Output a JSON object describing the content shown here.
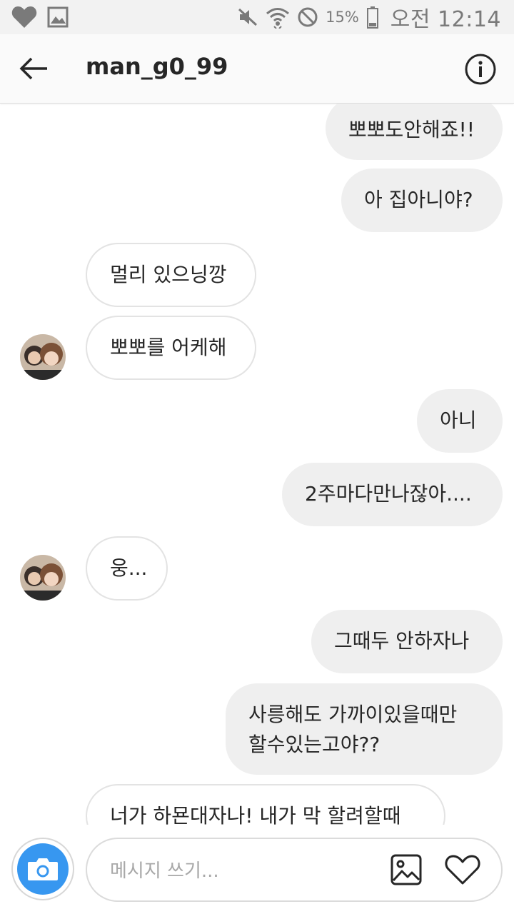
{
  "status_bar": {
    "icons": [
      "heart-icon",
      "gallery-icon",
      "mute-icon",
      "wifi-icon",
      "block-icon",
      "battery-icon"
    ],
    "battery_percent": "15%",
    "time": "오전 12:14"
  },
  "header": {
    "back_icon": "back-arrow-icon",
    "title": "man_g0_99",
    "info_icon": "info-icon"
  },
  "messages": [
    {
      "direction": "outgoing",
      "text": "뽀뽀도안해죠!!"
    },
    {
      "direction": "outgoing",
      "text": "아 집아니야?"
    },
    {
      "direction": "incoming",
      "text": "멀리 있으닝깡"
    },
    {
      "direction": "incoming",
      "text": "뽀뽀를 어케해",
      "avatar": true
    },
    {
      "direction": "outgoing",
      "text": "아니"
    },
    {
      "direction": "outgoing",
      "text": "2주마다만나잖아...."
    },
    {
      "direction": "incoming",
      "text": "웅...",
      "avatar": true
    },
    {
      "direction": "outgoing",
      "text": "그때두 안하자나"
    },
    {
      "direction": "outgoing",
      "lines": [
        "사릉해도 가까이있을때만",
        "할수있는고야??"
      ]
    },
    {
      "direction": "incoming",
      "text": "너가 하묜대자나! 내가 막 할려할때"
    }
  ],
  "composer": {
    "camera_icon": "camera-icon",
    "placeholder": "메시지 쓰기...",
    "value": "",
    "gallery_icon": "image-icon",
    "like_icon": "heart-outline-icon"
  },
  "colors": {
    "accent": "#3797f0",
    "outgoing_bubble": "#efefef",
    "incoming_border": "#e3e3e3",
    "text": "#262626",
    "placeholder": "#a8a8a8"
  }
}
